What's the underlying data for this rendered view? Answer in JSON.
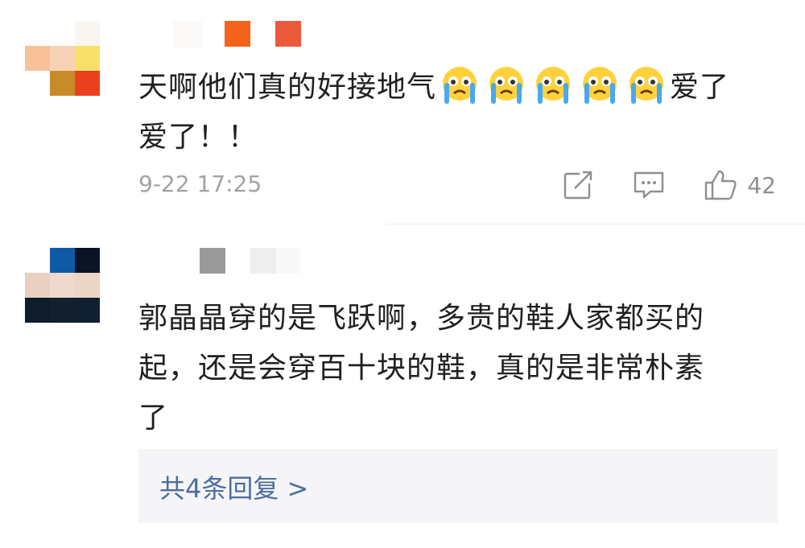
{
  "comments": [
    {
      "text": "天啊他们真的好接地气",
      "emoji": [
        "crying-face-emoji",
        "crying-face-emoji",
        "crying-face-emoji",
        "crying-face-emoji",
        "crying-face-emoji"
      ],
      "text_after_emoji_line1": "爱了",
      "text_line2": "爱了！！",
      "timestamp": "9-22 17:25",
      "likes": "42"
    },
    {
      "text_line1": "郭晶晶穿的是飞跃啊，多贵的鞋人家都买的",
      "text_line2": "起，还是会穿百十块的鞋，真的是非常朴素",
      "text_line3": "了",
      "replies_label": "共4条回复 >"
    }
  ],
  "icons": {
    "share": "share-icon",
    "comment": "comment-icon",
    "like": "thumbs-up-icon"
  },
  "colors": {
    "link": "#4b6e9f",
    "meta": "#a2a2a2",
    "reply_bg": "#f5f5f7"
  }
}
